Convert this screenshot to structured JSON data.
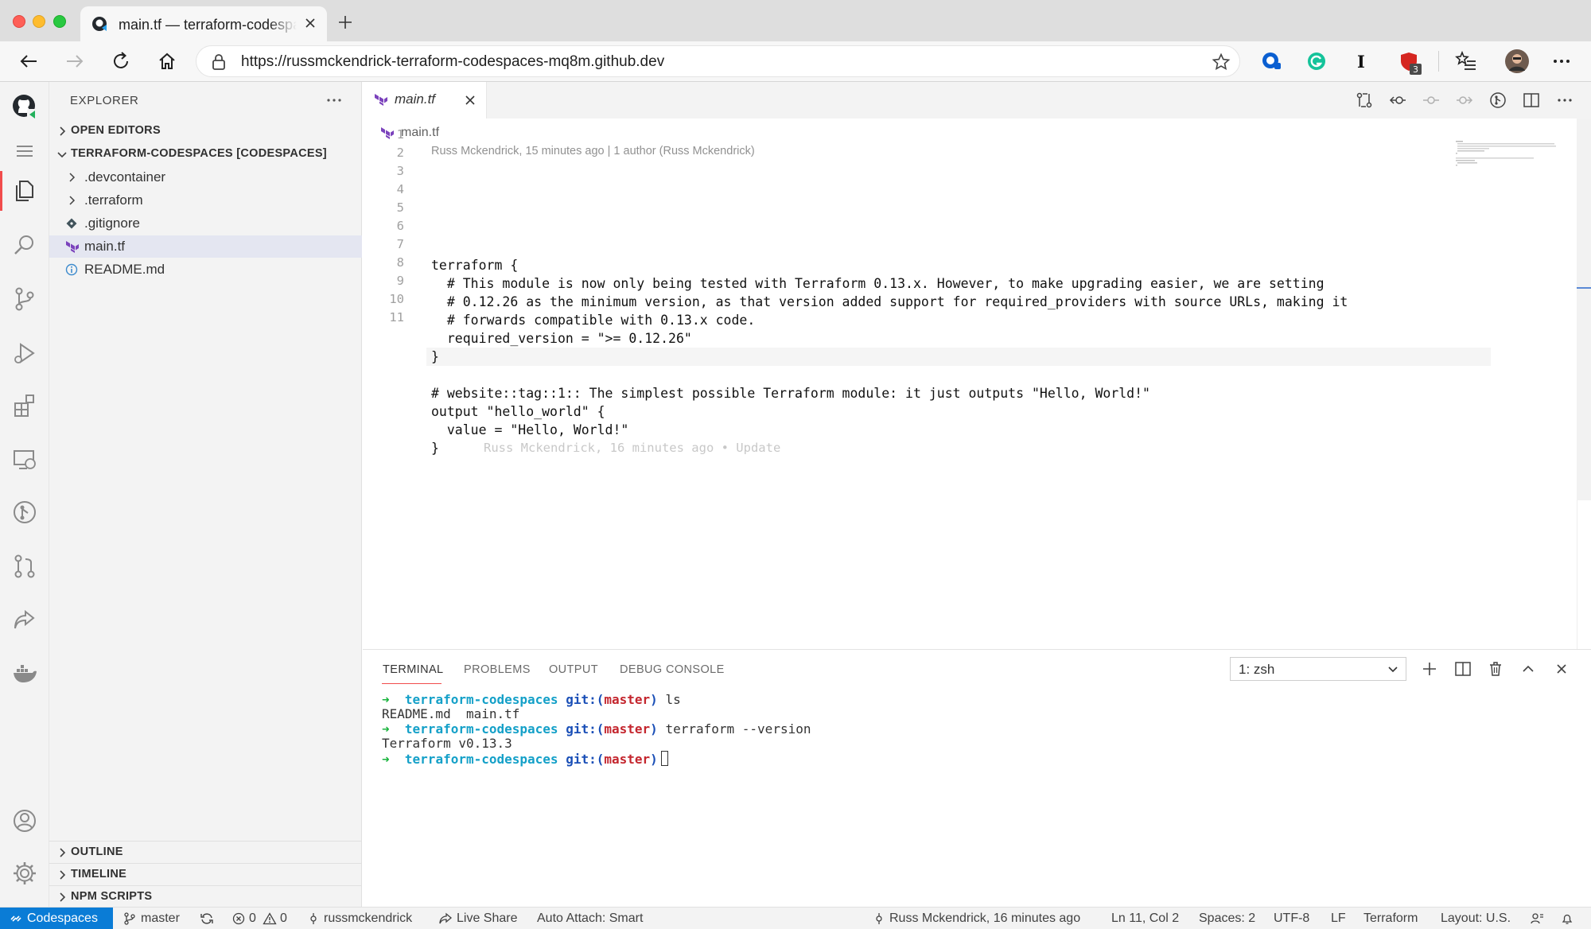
{
  "browser": {
    "tab_title": "main.tf — terraform-codespaces",
    "url": "https://russmckendrick-terraform-codespaces-mq8m.github.dev",
    "extension_badge": "3",
    "extension_letter": "I"
  },
  "sidebar": {
    "title": "EXPLORER",
    "more_label": "···",
    "open_editors": "OPEN EDITORS",
    "workspace": "TERRAFORM-CODESPACES [CODESPACES]",
    "items": [
      {
        "label": ".devcontainer"
      },
      {
        "label": ".terraform"
      },
      {
        "label": ".gitignore"
      },
      {
        "label": "main.tf"
      },
      {
        "label": "README.md"
      }
    ],
    "outline": "OUTLINE",
    "timeline": "TIMELINE",
    "npm_scripts": "NPM SCRIPTS"
  },
  "editor": {
    "tab_label": "main.tf",
    "breadcrumb": "main.tf",
    "codelens": "Russ Mckendrick, 15 minutes ago | 1 author (Russ Mckendrick)",
    "lines": [
      {
        "n": "1",
        "text": "terraform {"
      },
      {
        "n": "2",
        "text": "  # This module is now only being tested with Terraform 0.13.x. However, to make upgrading easier, we are setting"
      },
      {
        "n": "3",
        "text": "  # 0.12.26 as the minimum version, as that version added support for required_providers with source URLs, making it"
      },
      {
        "n": "4",
        "text": "  # forwards compatible with 0.13.x code."
      },
      {
        "n": "5",
        "text": "  required_version = \">= 0.12.26\""
      },
      {
        "n": "6",
        "text": "}"
      },
      {
        "n": "7",
        "text": ""
      },
      {
        "n": "8",
        "text": "# website::tag::1:: The simplest possible Terraform module: it just outputs \"Hello, World!\""
      },
      {
        "n": "9",
        "text": "output \"hello_world\" {"
      },
      {
        "n": "10",
        "text": "  value = \"Hello, World!\""
      },
      {
        "n": "11",
        "text": "}"
      }
    ],
    "inline_blame": "Russ Mckendrick, 16 minutes ago • Update"
  },
  "panel": {
    "tabs": [
      "TERMINAL",
      "PROBLEMS",
      "OUTPUT",
      "DEBUG CONSOLE"
    ],
    "shell": "1: zsh",
    "terminal": {
      "arrow": "➜",
      "dir": "terraform-codespaces",
      "git_prefix": "git:(",
      "branch": "master",
      "git_suffix": ")",
      "cmd1": "ls",
      "out1": "README.md  main.tf",
      "cmd2": "terraform --version",
      "out2": "Terraform v0.13.3"
    }
  },
  "statusbar": {
    "remote": "Codespaces",
    "branch": "master",
    "errors": "0",
    "warnings": "0",
    "account": "russmckendrick",
    "live_share": "Live Share",
    "auto_attach": "Auto Attach: Smart",
    "blame": "Russ Mckendrick, 16 minutes ago",
    "position": "Ln 11, Col 2",
    "spaces": "Spaces: 2",
    "encoding": "UTF-8",
    "eol": "LF",
    "language": "Terraform",
    "layout": "Layout: U.S."
  },
  "colors": {
    "accent_blue": "#0a7cd6",
    "active_tab_underline": "#f14c4c",
    "terraform_purple": "#7b42bc",
    "terminal_green": "#17b33b",
    "terminal_cyan": "#14a0c8",
    "terminal_red": "#c4262e"
  }
}
